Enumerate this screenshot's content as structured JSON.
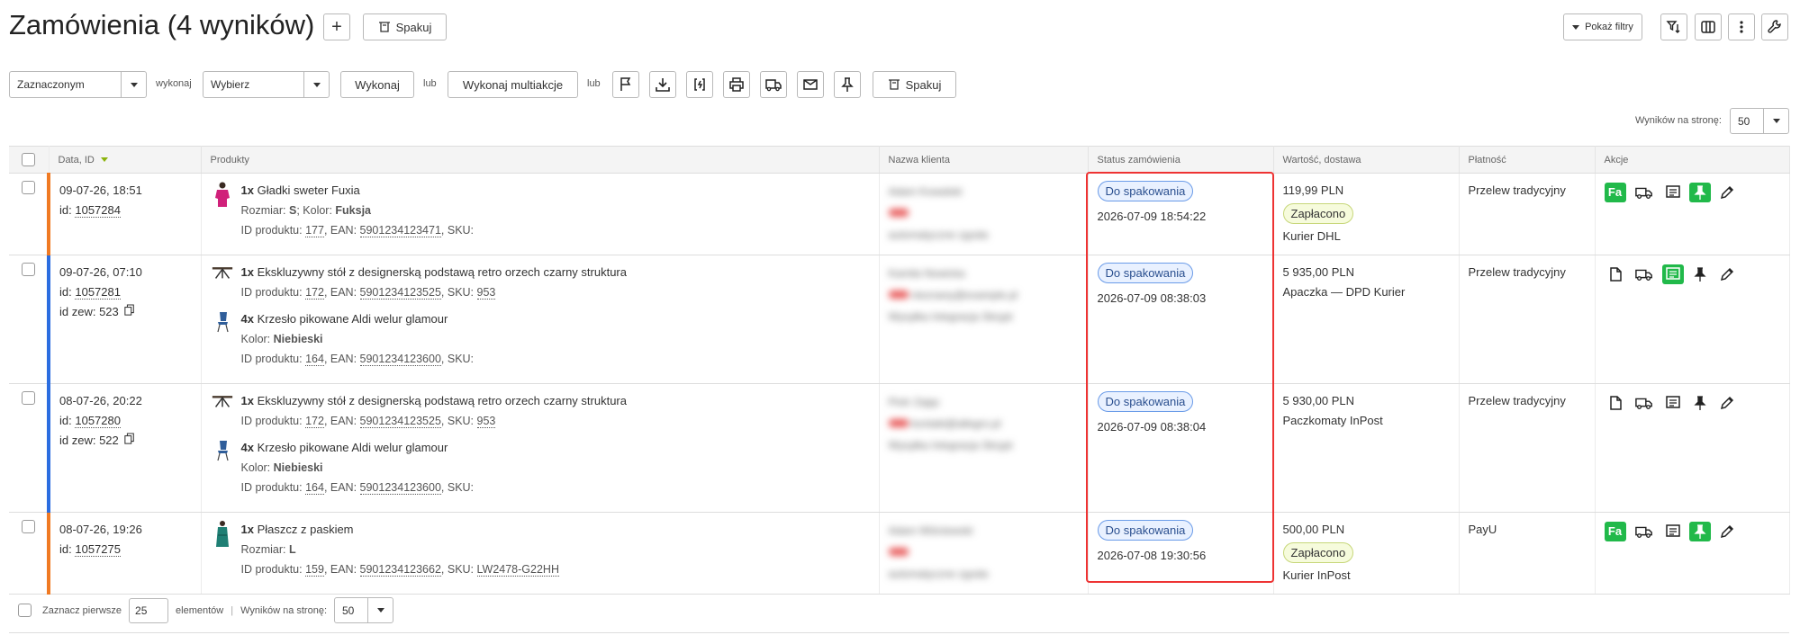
{
  "header": {
    "title": "Zamówienia (4 wyników)",
    "add_label": "+",
    "pack_label": "Spakuj",
    "show_filters_label": "Pokaż filtry"
  },
  "toolbar": {
    "selection_value": "Zaznaczonym",
    "execute_lbl": "wykonaj",
    "action_value": "Wybierz",
    "execute_button": "Wykonaj",
    "or1": "lub",
    "multi_button": "Wykonaj multiakcje",
    "or2": "lub",
    "pack_label": "Spakuj",
    "per_page_label": "Wyników na stronę:",
    "per_page_value": "50"
  },
  "table": {
    "columns": [
      "Data, ID",
      "Produkty",
      "Nazwa klienta",
      "Status zamówienia",
      "Wartość, dostawa",
      "Płatność",
      "Akcje"
    ],
    "rows": [
      {
        "date": "09-07-26, 18:51",
        "id_label": "id:",
        "id": "1057284",
        "ext_label": "",
        "ext_id": "",
        "bar": "orange",
        "products": [
          {
            "qty": "1x",
            "name": "Gładki sweter Fuxia",
            "l2_label": "Rozmiar: ",
            "l2_strong": "S",
            "l2_mid": "; Kolor: ",
            "l2_strong2": "Fuksja",
            "pid_label": "ID produktu: ",
            "pid": "177",
            "ean_label": ", EAN: ",
            "ean": "5901234123471",
            "sku_label": ", SKU:",
            "sku": "",
            "thumb": "sweater"
          }
        ],
        "client": [
          "Adam Kowalski",
          "",
          "automatyczne zgoda"
        ],
        "status": "Do spakowania",
        "status_date": "2026-07-09 18:54:22",
        "value": "119,99 PLN",
        "paid": "Zapłacono",
        "delivery": "Kurier DHL",
        "payment": "Przelew tradycyjny",
        "actions": [
          "fa",
          "truck",
          "note",
          "pin-green",
          "edit"
        ]
      },
      {
        "date": "09-07-26, 07:10",
        "id_label": "id:",
        "id": "1057281",
        "ext_label": "id zew: ",
        "ext_id": "523",
        "bar": "blue",
        "products": [
          {
            "qty": "1x",
            "name": "Ekskluzywny stół z designerską podstawą retro orzech czarny struktura",
            "l2_label": "",
            "l2_strong": "",
            "l2_mid": "",
            "l2_strong2": "",
            "pid_label": "ID produktu: ",
            "pid": "172",
            "ean_label": ", EAN: ",
            "ean": "5901234123525",
            "sku_label": ", SKU: ",
            "sku": "953",
            "thumb": "table"
          },
          {
            "qty": "4x",
            "name": "Krzesło pikowane Aldi welur glamour",
            "l2_label": "Kolor: ",
            "l2_strong": "Niebieski",
            "l2_mid": "",
            "l2_strong2": "",
            "pid_label": "ID produktu: ",
            "pid": "164",
            "ean_label": ", EAN: ",
            "ean": "5901234123600",
            "sku_label": ", SKU:",
            "sku": "",
            "thumb": "chair"
          }
        ],
        "client": [
          "Kamila Nowicka",
          "nieznany@example.pl",
          "Wysyłka Integracja Skrypt"
        ],
        "status": "Do spakowania",
        "status_date": "2026-07-09 08:38:03",
        "value": "5 935,00 PLN",
        "paid": "",
        "delivery": "Apaczka — DPD Kurier",
        "payment": "Przelew tradycyjny",
        "actions": [
          "doc",
          "truck",
          "note-green",
          "pin",
          "edit"
        ]
      },
      {
        "date": "08-07-26, 20:22",
        "id_label": "id:",
        "id": "1057280",
        "ext_label": "id zew: ",
        "ext_id": "522",
        "bar": "blue",
        "products": [
          {
            "qty": "1x",
            "name": "Ekskluzywny stół z designerską podstawą retro orzech czarny struktura",
            "l2_label": "",
            "l2_strong": "",
            "l2_mid": "",
            "l2_strong2": "",
            "pid_label": "ID produktu: ",
            "pid": "172",
            "ean_label": ", EAN: ",
            "ean": "5901234123525",
            "sku_label": ", SKU: ",
            "sku": "953",
            "thumb": "table"
          },
          {
            "qty": "4x",
            "name": "Krzesło pikowane Aldi welur glamour",
            "l2_label": "Kolor: ",
            "l2_strong": "Niebieski",
            "l2_mid": "",
            "l2_strong2": "",
            "pid_label": "ID produktu: ",
            "pid": "164",
            "ean_label": ", EAN: ",
            "ean": "5901234123600",
            "sku_label": ", SKU:",
            "sku": "",
            "thumb": "chair"
          }
        ],
        "client": [
          "Piotr Zając",
          "kontakt@allegro.pl",
          "Wysyłka Integracja Skrypt"
        ],
        "status": "Do spakowania",
        "status_date": "2026-07-09 08:38:04",
        "value": "5 930,00 PLN",
        "paid": "",
        "delivery": "Paczkomaty InPost",
        "payment": "Przelew tradycyjny",
        "actions": [
          "doc",
          "truck",
          "note",
          "pin",
          "edit"
        ]
      },
      {
        "date": "08-07-26, 19:26",
        "id_label": "id:",
        "id": "1057275",
        "ext_label": "",
        "ext_id": "",
        "bar": "orange",
        "products": [
          {
            "qty": "1x",
            "name": "Płaszcz z paskiem",
            "l2_label": "Rozmiar: ",
            "l2_strong": "L",
            "l2_mid": "",
            "l2_strong2": "",
            "pid_label": "ID produktu: ",
            "pid": "159",
            "ean_label": ", EAN: ",
            "ean": "5901234123662",
            "sku_label": ", SKU: ",
            "sku": "LW2478-G22HH",
            "thumb": "coat"
          }
        ],
        "client": [
          "Adam Wiśniewski",
          "",
          "automatyczne zgoda"
        ],
        "status": "Do spakowania",
        "status_date": "2026-07-08 19:30:56",
        "value": "500,00 PLN",
        "paid": "Zapłacono",
        "delivery": "Kurier InPost",
        "payment": "PayU",
        "actions": [
          "fa",
          "truck",
          "note",
          "pin-green",
          "edit"
        ]
      }
    ]
  },
  "footer": {
    "select_first_label": "Zaznacz pierwsze",
    "select_first_value": "25",
    "elements_label": "elementów",
    "per_page_label": "Wyników na stronę:",
    "per_page_value": "50"
  },
  "colors": {
    "accent_green": "#21b94a",
    "status_blue": "#6a9be8",
    "bar_orange": "#f07a23",
    "bar_blue": "#2b6de0",
    "highlight": "#ee3333"
  }
}
